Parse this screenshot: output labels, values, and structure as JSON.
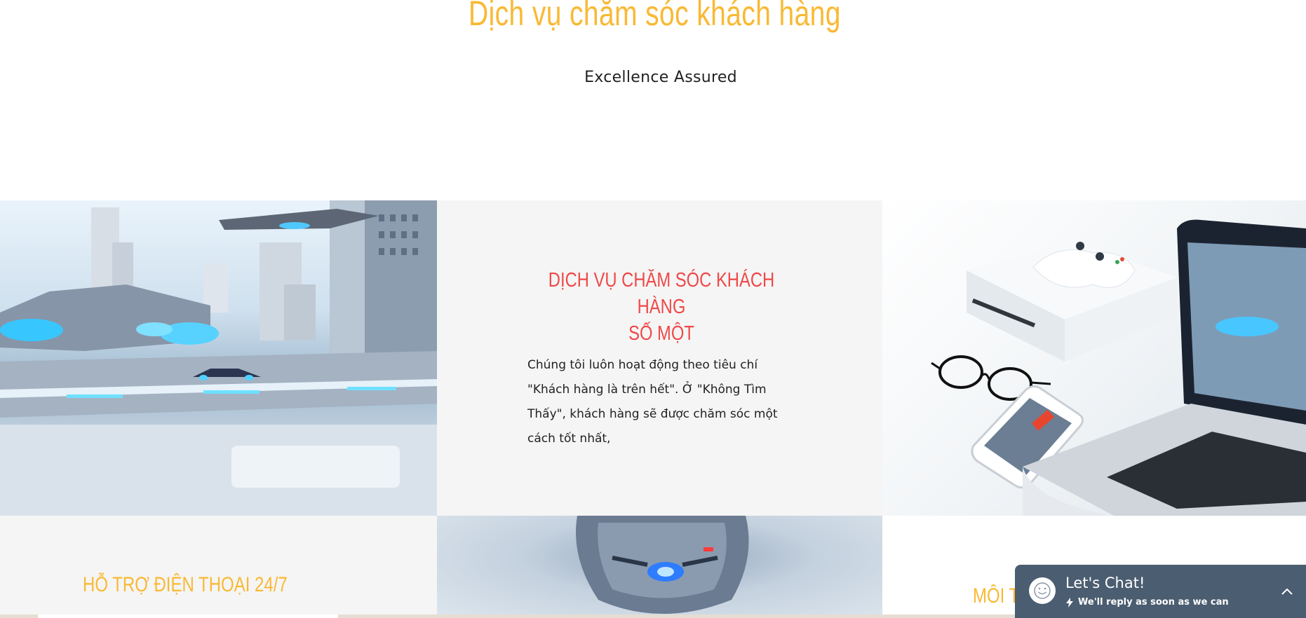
{
  "hero": {
    "title": "Dịch vụ chăm sóc khách hàng",
    "subtitle": "Excellence Assured"
  },
  "feature_card": {
    "heading_line1": "DỊCH VỤ CHĂM SÓC KHÁCH HÀNG",
    "heading_line2": "SỐ MỘT",
    "body": "Chúng tôi luôn hoạt động theo tiêu chí \"Khách hàng là trên hết\". Ở \"Không Tìm Thấy\", khách hàng sẽ được chăm sóc một cách tốt nhất,"
  },
  "bottom_left": {
    "heading": "HỖ TRỢ ĐIỆN THOẠI 24/7"
  },
  "bottom_right": {
    "heading": "MÔI T"
  },
  "chat_widget": {
    "title": "Let's Chat!",
    "subtitle": "We'll reply as soon as we can",
    "bg_color": "#4b5d70"
  },
  "colors": {
    "accent_yellow": "#f9b934",
    "accent_red": "#f04848",
    "panel_grey": "#f5f5f5"
  },
  "icons": [
    "smiley-avatar-icon",
    "lightning-icon",
    "chevron-up-icon"
  ]
}
